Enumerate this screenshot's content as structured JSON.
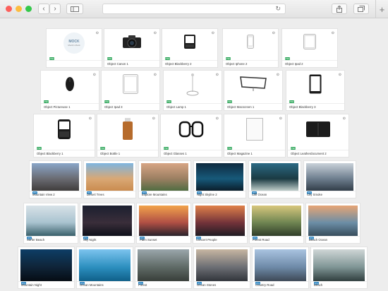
{
  "browser": {
    "traffic_lights": [
      "#fc605c",
      "#fdbc40",
      "#34c84a"
    ],
    "back_icon": "chevron-left-icon",
    "forward_icon": "chevron-right-icon",
    "sidebar_icon": "sidebar-icon",
    "reload_icon": "reload-icon",
    "share_icon": "share-icon",
    "tabs_icon": "tabs-icon",
    "new_tab_icon": "plus-icon"
  },
  "objects": [
    {
      "label": "",
      "art": "mockup-logo",
      "logo": "MOCK",
      "sublabel": "Mock's Mock"
    },
    {
      "label": "Object Canon 1",
      "art": "camera"
    },
    {
      "label": "Object Blackberry 2",
      "art": "blackberry-wide"
    },
    {
      "label": "Object Iphone 2",
      "art": "iphone"
    },
    {
      "label": "Object Ipad 2",
      "art": "ipad"
    },
    {
      "label": "Object Pictureuse 1",
      "art": "mouse"
    },
    {
      "label": "Object Ipad 3",
      "art": "ipad-white"
    },
    {
      "label": "Object Lamp 1",
      "art": "lamp"
    },
    {
      "label": "Object Macscreen 1",
      "art": "monitor"
    },
    {
      "label": "Object Blackberry 3",
      "art": "tablet-dark"
    },
    {
      "label": "Object Blackberry 1",
      "art": "blackberry"
    },
    {
      "label": "Object Bottle 1",
      "art": "bottle"
    },
    {
      "label": "Object Glasses 1",
      "art": "glasses"
    },
    {
      "label": "Object Magazine 1",
      "art": "magazine"
    },
    {
      "label": "Object Leatherdocument 2",
      "art": "wallet"
    }
  ],
  "photos": [
    {
      "label": "Mountain View 2",
      "colors": [
        "#8aa6c9",
        "#6a6b72",
        "#3d3a39"
      ]
    },
    {
      "label": "Desert Trees",
      "colors": [
        "#7eb5e0",
        "#d9a875",
        "#c98a4d"
      ]
    },
    {
      "label": "Explore Mountains",
      "colors": [
        "#d7a585",
        "#9b7f62",
        "#4c6b3f"
      ]
    },
    {
      "label": "Night Skyline 2",
      "colors": [
        "#0f2a3f",
        "#17597a",
        "#0a1a26"
      ]
    },
    {
      "label": "Cliff Ocean",
      "colors": [
        "#2c6a84",
        "#1a3a42",
        "#c9d6d2"
      ]
    },
    {
      "label": "City Smoke",
      "colors": [
        "#c9d1d9",
        "#6e7e8e",
        "#2e3a45"
      ]
    },
    {
      "label": "Surfer Beach",
      "colors": [
        "#d8e2e8",
        "#a9c3cf",
        "#335b66"
      ]
    },
    {
      "label": "Sky Night",
      "colors": [
        "#1b1f2f",
        "#3a2e3a",
        "#0c0f18"
      ]
    },
    {
      "label": "Palm Sunset",
      "colors": [
        "#f2a34b",
        "#b04f45",
        "#22202a"
      ]
    },
    {
      "label": "Concert People",
      "colors": [
        "#e0814a",
        "#74333a",
        "#1b1b22"
      ]
    },
    {
      "label": "Forest Road",
      "colors": [
        "#d8c77d",
        "#6f8552",
        "#2d3a27"
      ]
    },
    {
      "label": "Beach Ocean",
      "colors": [
        "#e7a575",
        "#6c8ea6",
        "#354a59"
      ]
    },
    {
      "label": "Mountain Night",
      "colors": [
        "#0e3e66",
        "#0f2438",
        "#050b12"
      ]
    },
    {
      "label": "Ocean Mountains",
      "colors": [
        "#7cc3ee",
        "#2c8fbf",
        "#0e5d86"
      ]
    },
    {
      "label": "Forest",
      "colors": [
        "#9aa6ab",
        "#5f6a66",
        "#363c37"
      ]
    },
    {
      "label": "Ocean Stones",
      "colors": [
        "#c7b6a2",
        "#6c6e74",
        "#2e3238"
      ]
    },
    {
      "label": "Country Road",
      "colors": [
        "#a9c3e0",
        "#6e8aa8",
        "#3b4552"
      ]
    },
    {
      "label": "Beach",
      "colors": [
        "#cfd6d6",
        "#7f9595",
        "#2c3a3a"
      ]
    }
  ],
  "badge": {
    "object": "PSD",
    "photo": "JPG"
  }
}
